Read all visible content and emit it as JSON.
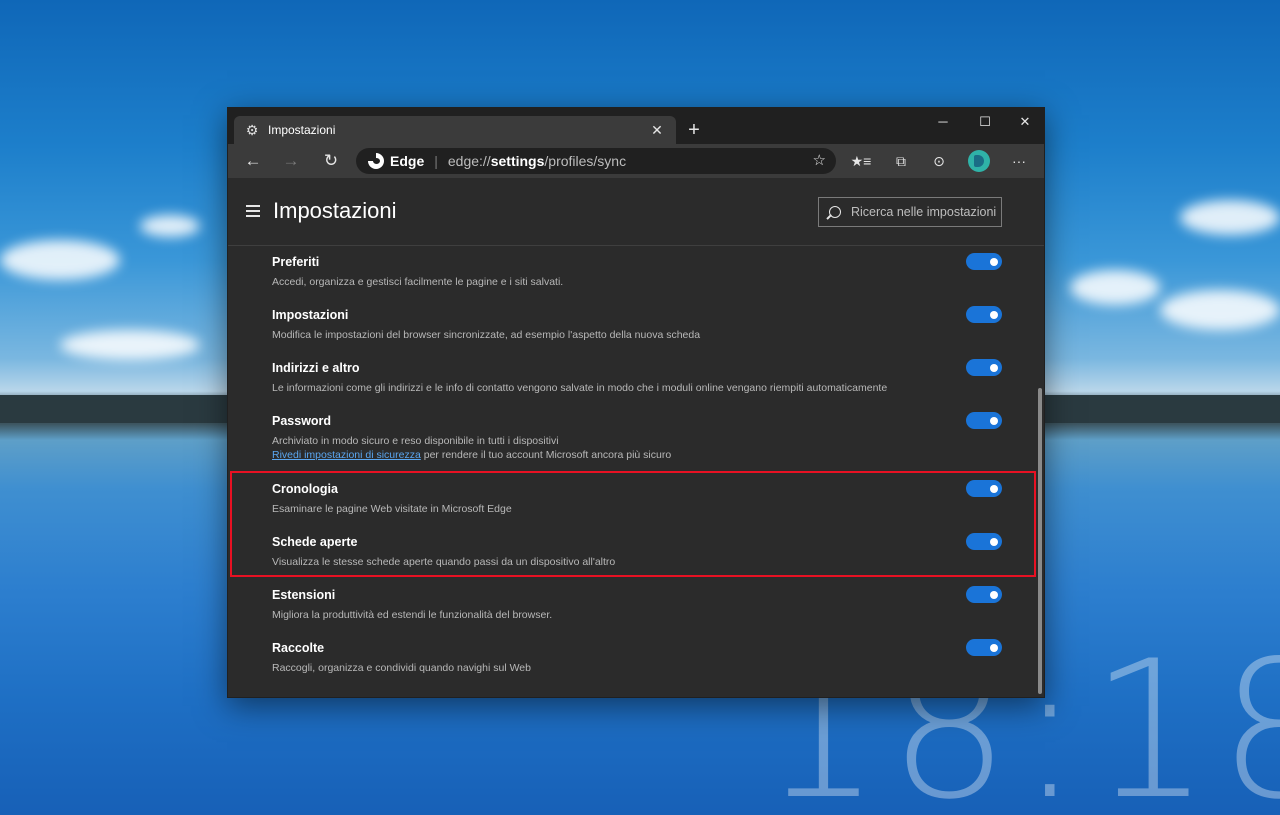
{
  "desktop": {
    "clock": "18:18"
  },
  "tab": {
    "title": "Impostazioni",
    "close": "✕",
    "new_tab": "+"
  },
  "window_controls": {
    "minimize": "─",
    "maximize": "☐",
    "close": "✕"
  },
  "toolbar": {
    "back": "←",
    "forward": "→",
    "refresh": "↻",
    "address": {
      "brand": "Edge",
      "separator": "|",
      "url_prefix": "edge://",
      "url_bold": "settings",
      "url_suffix": "/profiles/sync"
    },
    "favorite": "☆",
    "more": "···"
  },
  "header": {
    "title": "Impostazioni",
    "search_placeholder": "Ricerca nelle impostazioni"
  },
  "items": [
    {
      "title": "Preferiti",
      "desc": "Accedi, organizza e gestisci facilmente le pagine e i siti salvati.",
      "enabled": true
    },
    {
      "title": "Impostazioni",
      "desc": "Modifica le impostazioni del browser sincronizzate, ad esempio l'aspetto della nuova scheda",
      "enabled": true
    },
    {
      "title": "Indirizzi e altro",
      "desc": "Le informazioni come gli indirizzi e le info di contatto vengono salvate in modo che i moduli online vengano riempiti automaticamente",
      "enabled": true
    },
    {
      "title": "Password",
      "desc": "Archiviato in modo sicuro e reso disponibile in tutti i dispositivi",
      "link": "Rivedi impostazioni di sicurezza",
      "link_suffix": " per rendere il tuo account Microsoft ancora più sicuro",
      "enabled": true
    },
    {
      "title": "Cronologia",
      "desc": "Esaminare le pagine Web visitate in Microsoft Edge",
      "enabled": true
    },
    {
      "title": "Schede aperte",
      "desc": "Visualizza le stesse schede aperte quando passi da un dispositivo all'altro",
      "enabled": true
    },
    {
      "title": "Estensioni",
      "desc": "Migliora la produttività ed estendi le funzionalità del browser.",
      "enabled": true
    },
    {
      "title": "Raccolte",
      "desc": "Raccogli, organizza e condividi quando navighi sul Web",
      "enabled": true
    }
  ],
  "colors": {
    "accent": "#1a74d8",
    "highlight": "#e81123"
  }
}
